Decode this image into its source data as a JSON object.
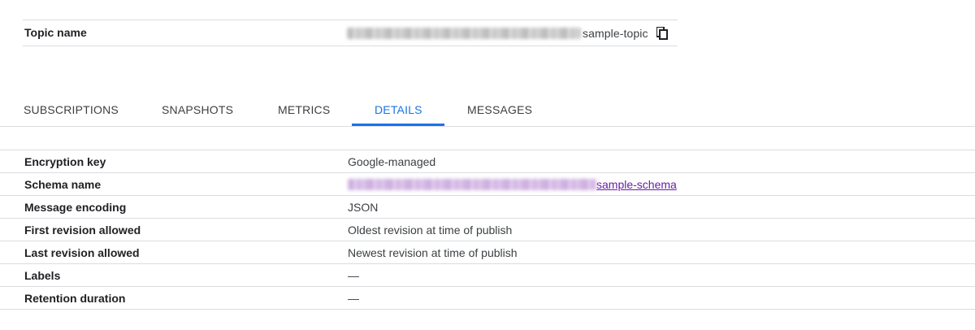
{
  "topic": {
    "label": "Topic name",
    "value_suffix": "sample-topic",
    "copy_icon": "content-copy-icon"
  },
  "tabs": [
    {
      "label": "SUBSCRIPTIONS",
      "active": false
    },
    {
      "label": "SNAPSHOTS",
      "active": false
    },
    {
      "label": "METRICS",
      "active": false
    },
    {
      "label": "DETAILS",
      "active": true
    },
    {
      "label": "MESSAGES",
      "active": false
    }
  ],
  "details": {
    "encryption_key": {
      "label": "Encryption key",
      "value": "Google-managed"
    },
    "schema_name": {
      "label": "Schema name",
      "value_suffix": "sample-schema"
    },
    "message_encoding": {
      "label": "Message encoding",
      "value": "JSON"
    },
    "first_revision": {
      "label": "First revision allowed",
      "value": "Oldest revision at time of publish"
    },
    "last_revision": {
      "label": "Last revision allowed",
      "value": "Newest revision at time of publish"
    },
    "labels": {
      "label": "Labels",
      "value": "—"
    },
    "retention": {
      "label": "Retention duration",
      "value": "—"
    }
  },
  "colors": {
    "accent": "#1a73e8",
    "link_visited": "#681da8",
    "divider": "#dadce0"
  }
}
